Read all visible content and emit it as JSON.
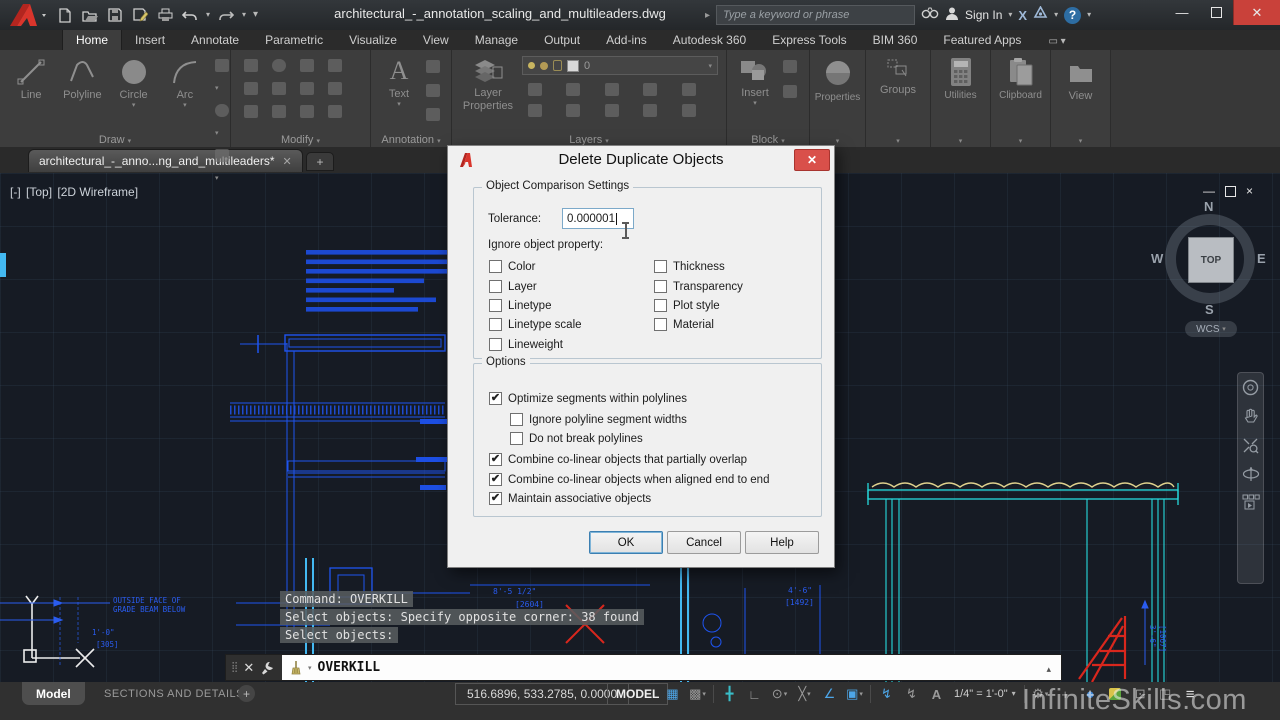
{
  "glyphs": {
    "caret": "▾",
    "caret_up": "▴",
    "close": "×",
    "minimize": "—",
    "plus": "+",
    "question": "?",
    "grip": "⣿",
    "x_mark": "✕",
    "check": "✔",
    "menu": "≡"
  },
  "window": {
    "title": "architectural_-_annotation_scaling_and_multileaders.dwg",
    "search_placeholder": "Type a keyword or phrase",
    "sign_in": "Sign In",
    "exchange_label": "X"
  },
  "ribbon": {
    "tabs": [
      "Home",
      "Insert",
      "Annotate",
      "Parametric",
      "Visualize",
      "View",
      "Manage",
      "Output",
      "Add-ins",
      "Autodesk 360",
      "Express Tools",
      "BIM 360",
      "Featured Apps"
    ],
    "panels": {
      "draw": {
        "label": "Draw",
        "tools": [
          "Line",
          "Polyline",
          "Circle",
          "Arc"
        ]
      },
      "modify": {
        "label": "Modify"
      },
      "annotation": {
        "label": "Annotation",
        "text_tool": "Text",
        "big_a": "A"
      },
      "layers": {
        "label": "Layers",
        "layer_properties": "Layer Properties",
        "current_layer": "0"
      },
      "block": {
        "label": "Block",
        "insert_tool": "Insert"
      },
      "properties": {
        "label": "Properties"
      },
      "groups": {
        "label": "Groups"
      },
      "utilities": {
        "label": "Utilities"
      },
      "clipboard": {
        "label": "Clipboard"
      },
      "view": {
        "label": "View"
      }
    }
  },
  "file_tab": {
    "name": "architectural_-_anno...ng_and_multileaders*"
  },
  "viewport": {
    "controls": "[-]",
    "view": "[Top]",
    "visual_style": "[2D Wireframe]",
    "viewcube": {
      "n": "N",
      "s": "S",
      "e": "E",
      "w": "W",
      "face": "TOP",
      "wcs": "WCS"
    }
  },
  "canvas": {
    "history": [
      "Command: OVERKILL",
      "Select objects: Specify opposite corner: 38 found",
      "Select objects:"
    ],
    "annotations": {
      "note_a": "OUTSIDE FACE OF",
      "note_b": "GRADE BEAM BELOW",
      "dim_a": "1'-0\"",
      "dim_b": "[305]",
      "dim_c": "8'-5 1/2\"",
      "dim_d": "[2604]",
      "dim_e": "4'-6\"",
      "dim_f": "[1492]",
      "dim_g": "3'-6\"",
      "dim_h": "[1067]"
    }
  },
  "command_bar": {
    "value": "OVERKILL"
  },
  "status_bar": {
    "model_tab": "Model",
    "layout_tab": "SECTIONS AND DETAILS",
    "coords": "516.6896, 533.2785, 0.0000",
    "space": "MODEL",
    "scale": "1/4\" = 1'-0\"",
    "icons": [
      {
        "glyph": "▦",
        "color": "#4da6e8"
      },
      {
        "glyph": "▩",
        "color": "#9a9a9a"
      },
      {
        "glyph": "╋",
        "color": "#39bdc8"
      },
      {
        "glyph": "∟",
        "color": "#9a9a9a"
      },
      {
        "glyph": "⊙",
        "color": "#9a9a9a"
      },
      {
        "glyph": "╳",
        "color": "#9a9a9a"
      },
      {
        "glyph": "∠",
        "color": "#4da6e8"
      },
      {
        "glyph": "▣",
        "color": "#4da6e8"
      },
      {
        "glyph": "↯",
        "color": "#4da6e8"
      },
      {
        "glyph": "↯",
        "color": "#9a9a9a"
      },
      {
        "glyph": "A",
        "color": "#9a9a9a"
      },
      {
        "glyph": "⚙",
        "color": "#9a9a9a"
      },
      {
        "glyph": "+",
        "color": "#9a9a9a"
      },
      {
        "glyph": "●",
        "color": "#3f87d6"
      },
      {
        "glyph": "⊡",
        "color": "#9a9a9a"
      },
      {
        "glyph": "◳",
        "color": "#9a9a9a"
      },
      {
        "glyph": "≡",
        "color": "#e0e0e0"
      }
    ]
  },
  "dialog": {
    "title": "Delete Duplicate Objects",
    "comparison": {
      "legend": "Object Comparison Settings",
      "tolerance_label": "Tolerance:",
      "tolerance_value": "0.000001",
      "ignore_label": "Ignore object property:",
      "left": [
        {
          "label": "Color",
          "mark": ""
        },
        {
          "label": "Layer",
          "mark": ""
        },
        {
          "label": "Linetype",
          "mark": ""
        },
        {
          "label": "Linetype scale",
          "mark": ""
        },
        {
          "label": "Lineweight",
          "mark": ""
        }
      ],
      "right": [
        {
          "label": "Thickness",
          "mark": ""
        },
        {
          "label": "Transparency",
          "mark": ""
        },
        {
          "label": "Plot style",
          "mark": ""
        },
        {
          "label": "Material",
          "mark": ""
        }
      ]
    },
    "options": {
      "legend": "Options",
      "items": [
        {
          "label": "Optimize segments within polylines",
          "mark": "✔"
        },
        {
          "label": "Ignore polyline segment widths",
          "mark": ""
        },
        {
          "label": "Do not break polylines",
          "mark": ""
        },
        {
          "label": "Combine co-linear objects that partially overlap",
          "mark": "✔"
        },
        {
          "label": "Combine co-linear objects when aligned end to end",
          "mark": "✔"
        },
        {
          "label": "Maintain associative objects",
          "mark": "✔"
        }
      ]
    },
    "buttons": {
      "ok": "OK",
      "cancel": "Cancel",
      "help": "Help"
    }
  },
  "watermark": "InfiniteSkills.com"
}
